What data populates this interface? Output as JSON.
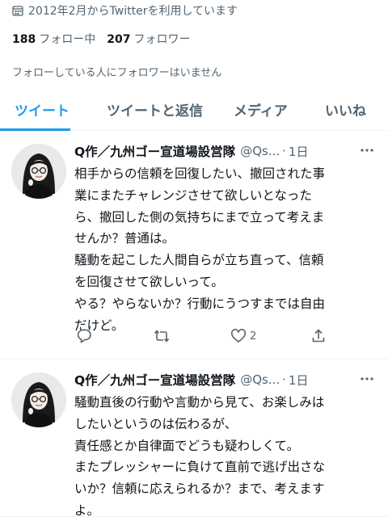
{
  "profile": {
    "joined": "2012年2月からTwitterを利用しています",
    "following_count": "188",
    "following_label": "フォロー中",
    "followers_count": "207",
    "followers_label": "フォロワー",
    "follower_note": "フォローしている人にフォロワーはいません"
  },
  "tabs": [
    {
      "label": "ツイート",
      "active": true
    },
    {
      "label": "ツイートと返信",
      "active": false
    },
    {
      "label": "メディア",
      "active": false
    },
    {
      "label": "いいね",
      "active": false
    }
  ],
  "tweets": [
    {
      "author": "Q作／九州ゴー宣道場設営隊",
      "handle": "@Qs...",
      "time": "1日",
      "lines": [
        "相手からの信頼を回復したい、撤回された事",
        "業にまたチャレンジさせて欲しいとなった",
        "ら、撤回した側の気持ちにまで立って考えま",
        "せんか？普通は。",
        "騒動を起こした人間自らが立ち直って、信頼",
        "を回復させて欲しいって。",
        "やる？やらないか？行動にうつすまでは自由",
        "だけど。"
      ],
      "like_count": "2"
    },
    {
      "author": "Q作／九州ゴー宣道場設営隊",
      "handle": "@Qs...",
      "time": "1日",
      "lines": [
        "騒動直後の行動や言動から見て、お楽しみは",
        "したいというのは伝わるが、",
        "責任感とか自律面でどうも疑わしくて。",
        "またプレッシャーに負けて直前で逃げ出さな",
        "いか？信頼に応えられるか？まで、考えます",
        "よ。"
      ]
    }
  ],
  "icons": {
    "joined": "calendar-icon",
    "more": "more-icon",
    "reply": "reply-icon",
    "retweet": "retweet-icon",
    "like": "heart-icon",
    "share": "share-icon"
  },
  "colors": {
    "accent": "#1d9bf0",
    "secondary_text": "#536471",
    "primary_text": "#0f1419"
  }
}
